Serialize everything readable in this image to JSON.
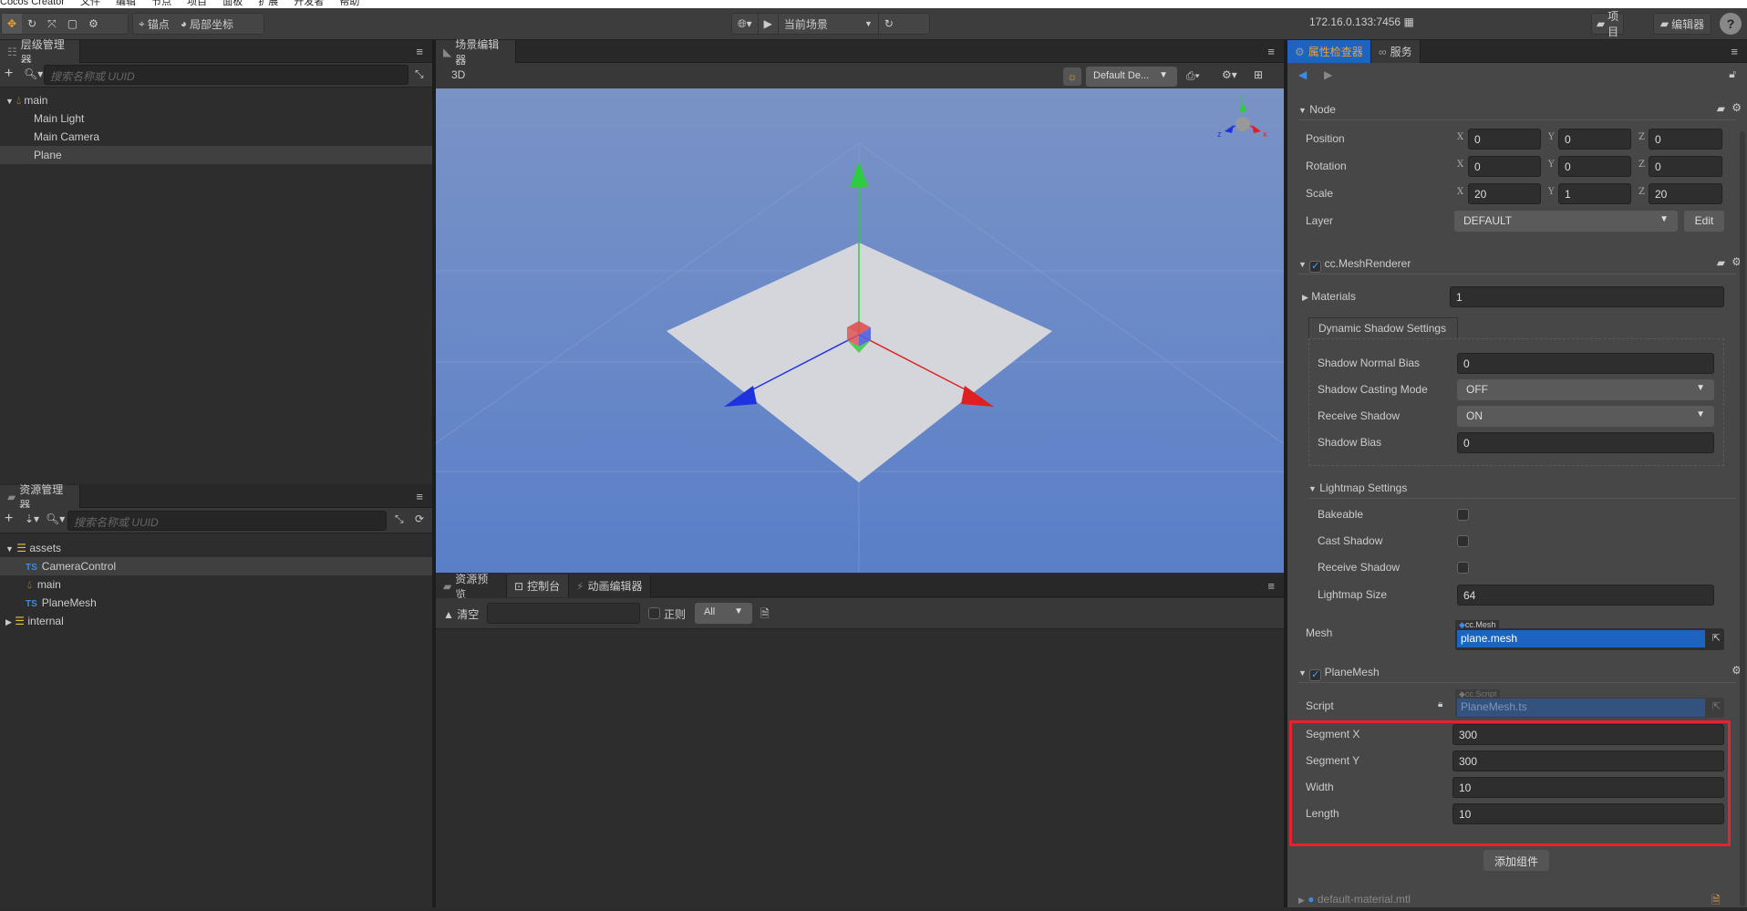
{
  "menubar": {
    "items": [
      "Cocos Creator",
      "文件",
      "编辑",
      "节点",
      "项目",
      "面板",
      "扩展",
      "开发者",
      "帮助"
    ]
  },
  "toolbar": {
    "anchor": "锚点",
    "local_coords": "局部坐标",
    "scene_select": "当前场景",
    "ip": "172.16.0.133:7456",
    "project": "项目",
    "editor": "编辑器",
    "help": "?"
  },
  "hierarchy": {
    "title": "层级管理器",
    "search_placeholder": "搜索名称或 UUID",
    "items": [
      {
        "label": "main"
      },
      {
        "label": "Main Light"
      },
      {
        "label": "Main Camera"
      },
      {
        "label": "Plane"
      }
    ]
  },
  "assets": {
    "title": "资源管理器",
    "search_placeholder": "搜索名称或 UUID",
    "items": [
      {
        "label": "assets"
      },
      {
        "label": "CameraControl",
        "type": "TS"
      },
      {
        "label": "main"
      },
      {
        "label": "PlaneMesh",
        "type": "TS"
      },
      {
        "label": "internal"
      }
    ]
  },
  "scene": {
    "title": "场景编辑器",
    "mode": "3D",
    "camera_select": "Default De..."
  },
  "console": {
    "tabs": [
      "资源预览",
      "控制台",
      "动画编辑器"
    ],
    "clear": "清空",
    "regex": "正则",
    "level": "All"
  },
  "inspector": {
    "tabs": [
      "属性检查器",
      "服务"
    ],
    "node": {
      "title": "Node",
      "position": {
        "label": "Position",
        "x": "0",
        "y": "0",
        "z": "0"
      },
      "rotation": {
        "label": "Rotation",
        "x": "0",
        "y": "0",
        "z": "0"
      },
      "scale": {
        "label": "Scale",
        "x": "20",
        "y": "1",
        "z": "20"
      },
      "layer": {
        "label": "Layer",
        "value": "DEFAULT",
        "edit": "Edit"
      },
      "axis": [
        "X",
        "Y",
        "Z"
      ]
    },
    "mesh_renderer": {
      "title": "cc.MeshRenderer",
      "materials_label": "Materials",
      "materials_value": "1",
      "shadow_tab": "Dynamic Shadow Settings",
      "shadow_normal_bias": {
        "label": "Shadow Normal Bias",
        "value": "0"
      },
      "shadow_casting_mode": {
        "label": "Shadow Casting Mode",
        "value": "OFF"
      },
      "receive_shadow": {
        "label": "Receive Shadow",
        "value": "ON"
      },
      "shadow_bias": {
        "label": "Shadow Bias",
        "value": "0"
      },
      "lightmap_title": "Lightmap Settings",
      "bakeable": "Bakeable",
      "cast_shadow": "Cast Shadow",
      "receive_shadow2": "Receive Shadow",
      "lightmap_size": {
        "label": "Lightmap Size",
        "value": "64"
      },
      "mesh": {
        "label": "Mesh",
        "type": "cc.Mesh",
        "value": "plane.mesh"
      }
    },
    "plane_mesh": {
      "title": "PlaneMesh",
      "script": {
        "label": "Script",
        "type": "cc.Script",
        "value": "PlaneMesh.ts"
      },
      "segment_x": {
        "label": "Segment X",
        "value": "300"
      },
      "segment_y": {
        "label": "Segment Y",
        "value": "300"
      },
      "width": {
        "label": "Width",
        "value": "10"
      },
      "length": {
        "label": "Length",
        "value": "10"
      }
    },
    "add_component": "添加组件",
    "material": "default-material.mtl"
  },
  "colors": {
    "accent": "#1e63c0",
    "highlight": "#e8222a"
  }
}
